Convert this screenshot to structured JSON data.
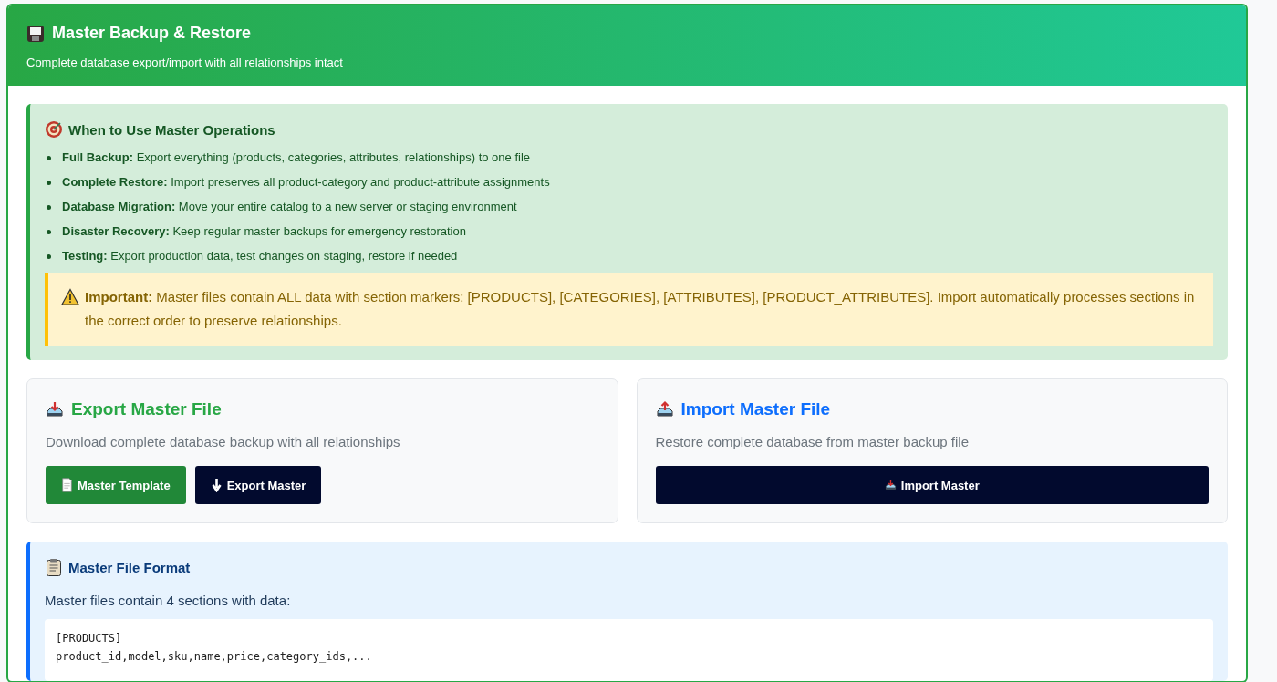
{
  "header": {
    "title": "Master Backup & Restore",
    "subtitle": "Complete database export/import with all relationships intact"
  },
  "usage": {
    "title": "When to Use Master Operations",
    "items": [
      "**Full Backup:** Export everything (products, categories, attributes, relationships) to one file",
      "**Complete Restore:** Import preserves all product-category and product-attribute assignments",
      "**Database Migration:** Move your entire catalog to a new server or staging environment",
      "**Disaster Recovery:** Keep regular master backups for emergency restoration",
      "**Testing:** Export production data, test changes on staging, restore if needed"
    ],
    "note": "**Important:** Master files contain ALL data with section markers: [PRODUCTS], [CATEGORIES], [ATTRIBUTES], [PRODUCT_ATTRIBUTES]. Import automatically processes sections in the correct order to preserve relationships."
  },
  "cards": [
    {
      "kind": "export",
      "title": "Export Master File",
      "description": "Download complete database backup with all relationships",
      "buttons": [
        {
          "kind": "template",
          "label": "Master Template"
        },
        {
          "kind": "export",
          "label": "Export Master"
        }
      ]
    },
    {
      "kind": "import",
      "title": "Import Master File",
      "description": "Restore complete database from master backup file",
      "buttons": [
        {
          "kind": "import",
          "label": "Import Master"
        }
      ]
    }
  ],
  "format": {
    "title": "Master File Format",
    "text": "Master files contain 4 sections with data:",
    "code_lines": [
      "[PRODUCTS]",
      "product_id,model,sku,name,price,category_ids,..."
    ]
  }
}
